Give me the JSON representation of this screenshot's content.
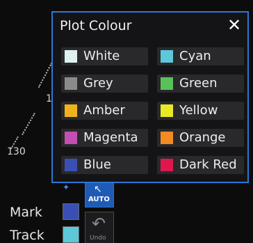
{
  "scope": {
    "range_label_130": "130",
    "range_label_1": "1"
  },
  "side_panel": {
    "mark_label": "Mark",
    "track_label": "Track",
    "mark_color": "#3a4fb4",
    "track_color": "#5ec7da",
    "auto_button_label": "AUTO",
    "undo_button_label": "Undo"
  },
  "dialog": {
    "title": "Plot Colour",
    "close_label": "✕",
    "options": [
      {
        "label": "White",
        "color": "#dff2f2"
      },
      {
        "label": "Cyan",
        "color": "#5ec7da"
      },
      {
        "label": "Grey",
        "color": "#8a8a8a"
      },
      {
        "label": "Green",
        "color": "#5cc05a"
      },
      {
        "label": "Amber",
        "color": "#f0b21c"
      },
      {
        "label": "Yellow",
        "color": "#e8e825"
      },
      {
        "label": "Magenta",
        "color": "#c34fb2"
      },
      {
        "label": "Orange",
        "color": "#f08c22"
      },
      {
        "label": "Blue",
        "color": "#3a4fb4"
      },
      {
        "label": "Dark Red",
        "color": "#e0174f"
      }
    ]
  }
}
